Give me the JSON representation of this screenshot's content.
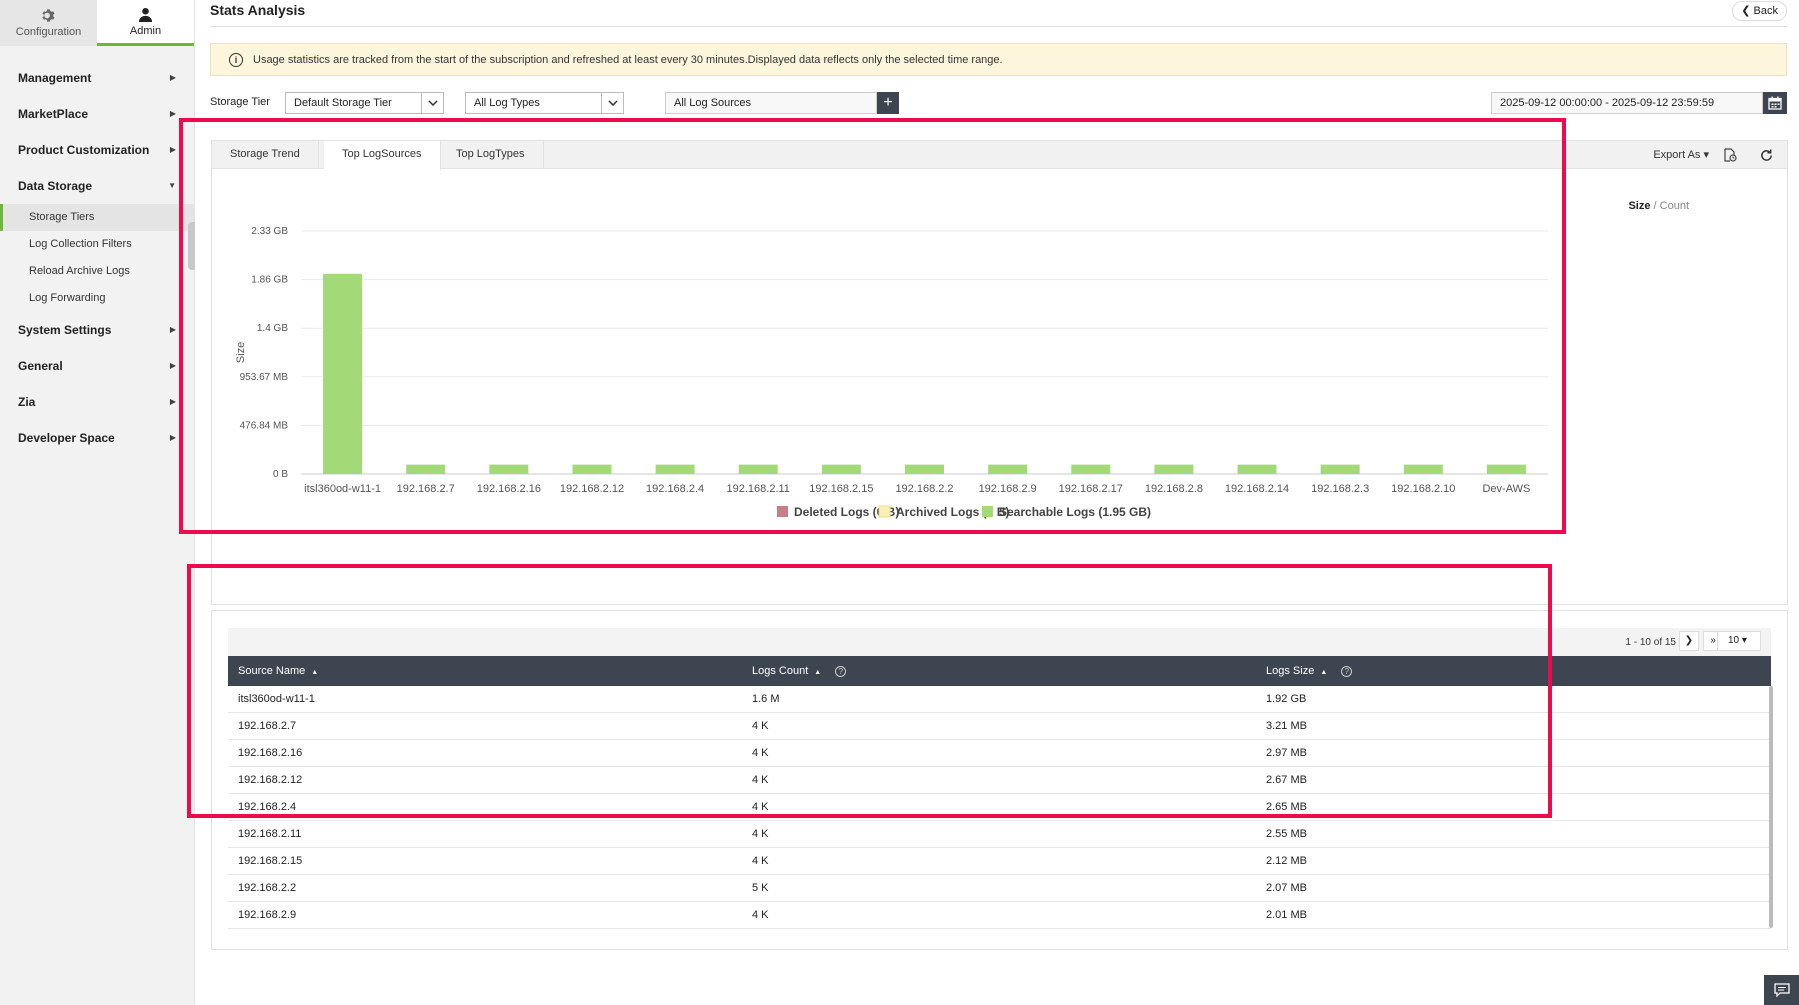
{
  "sidebar": {
    "tabs": [
      {
        "label": "Configuration",
        "icon": "gear-icon"
      },
      {
        "label": "Admin",
        "icon": "user-icon"
      }
    ],
    "menu": {
      "management": "Management",
      "marketplace": "MarketPlace",
      "product_customization": "Product Customization",
      "data_storage": "Data Storage",
      "storage_tiers": "Storage Tiers",
      "log_collection_filters": "Log Collection Filters",
      "reload_archive_logs": "Reload Archive Logs",
      "log_forwarding": "Log Forwarding",
      "system_settings": "System Settings",
      "general": "General",
      "zia": "Zia",
      "developer_space": "Developer Space"
    }
  },
  "header": {
    "title": "Stats Analysis",
    "back_label": "Back"
  },
  "notice": "Usage statistics are tracked from the start of the subscription and refreshed at least every 30 minutes.Displayed data reflects only the selected time range.",
  "filters": {
    "storage_tier_label": "Storage Tier",
    "storage_tier_value": "Default Storage Tier",
    "log_types_value": "All Log Types",
    "log_sources_value": "All Log Sources",
    "date_range": "2025-09-12 00:00:00 - 2025-09-12 23:59:59"
  },
  "tabs": {
    "storage_trend": "Storage Trend",
    "top_logsources": "Top LogSources",
    "top_logtypes": "Top LogTypes"
  },
  "toolbar": {
    "export_label": "Export As"
  },
  "toggle": {
    "size": "Size",
    "sep": "/",
    "count": "Count"
  },
  "chart_data": {
    "type": "bar",
    "ylabel": "Size",
    "y_ticks": [
      "0 B",
      "476.84 MB",
      "953.67 MB",
      "1.4 GB",
      "1.86 GB",
      "2.33 GB"
    ],
    "ylim_gb": [
      0,
      2.33
    ],
    "categories": [
      "itsl360od-w11-1",
      "192.168.2.7",
      "192.168.2.16",
      "192.168.2.12",
      "192.168.2.4",
      "192.168.2.11",
      "192.168.2.15",
      "192.168.2.2",
      "192.168.2.9",
      "192.168.2.17",
      "192.168.2.8",
      "192.168.2.14",
      "192.168.2.3",
      "192.168.2.10",
      "Dev-AWS"
    ],
    "series": [
      {
        "name": "Deleted Logs (0 B)",
        "color": "#c97e8a",
        "values": [
          0,
          0,
          0,
          0,
          0,
          0,
          0,
          0,
          0,
          0,
          0,
          0,
          0,
          0,
          0
        ]
      },
      {
        "name": "Archived Logs (0 B)",
        "color": "#f3dc7a",
        "values": [
          0,
          0,
          0,
          0,
          0,
          0,
          0,
          0,
          0,
          0,
          0,
          0,
          0,
          0,
          0
        ]
      },
      {
        "name": "Searchable Logs (1.95 GB)",
        "color": "#a3d977",
        "values": [
          1.92,
          0.09,
          0.09,
          0.09,
          0.09,
          0.09,
          0.09,
          0.09,
          0.09,
          0.09,
          0.09,
          0.09,
          0.09,
          0.09,
          0.09
        ]
      }
    ],
    "value_unit": "GB",
    "grid": true,
    "legend": "bottom-center"
  },
  "pager": {
    "range": "1 - 10 of 15",
    "page_size": "10"
  },
  "table": {
    "columns": [
      "Source Name",
      "Logs Count",
      "Logs Size"
    ],
    "rows": [
      [
        "itsl360od-w11-1",
        "1.6 M",
        "1.92 GB"
      ],
      [
        "192.168.2.7",
        "4 K",
        "3.21 MB"
      ],
      [
        "192.168.2.16",
        "4 K",
        "2.97 MB"
      ],
      [
        "192.168.2.12",
        "4 K",
        "2.67 MB"
      ],
      [
        "192.168.2.4",
        "4 K",
        "2.65 MB"
      ],
      [
        "192.168.2.11",
        "4 K",
        "2.55 MB"
      ],
      [
        "192.168.2.15",
        "4 K",
        "2.12 MB"
      ],
      [
        "192.168.2.2",
        "5 K",
        "2.07 MB"
      ],
      [
        "192.168.2.9",
        "4 K",
        "2.01 MB"
      ]
    ]
  },
  "colors": {
    "accent": "#6fb53f",
    "header_dark": "#3d4650",
    "highlight": "#ee0a4e",
    "notice_bg": "#fdf6dd"
  }
}
